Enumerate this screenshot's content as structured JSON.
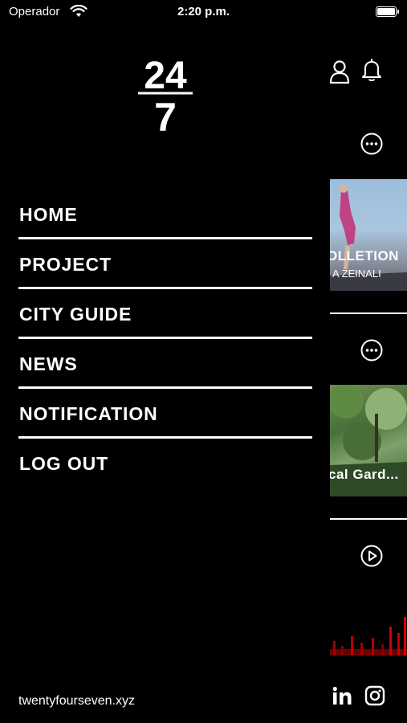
{
  "status_bar": {
    "carrier": "Operador",
    "time": "2:20 p.m."
  },
  "logo": {
    "top": "24",
    "bottom": "7"
  },
  "menu": {
    "items": [
      {
        "label": "HOME"
      },
      {
        "label": "PROJECT"
      },
      {
        "label": "CITY GUIDE"
      },
      {
        "label": "NEWS"
      },
      {
        "label": "NOTIFICATION"
      },
      {
        "label": "LOG OUT"
      }
    ]
  },
  "footer": {
    "website": "twentyfourseven.xyz"
  },
  "background_screen": {
    "card1": {
      "title": "OLLETION",
      "subtitle": "A ZEINALI"
    },
    "card2": {
      "title": "cal Gard..."
    }
  },
  "icons": [
    "wifi-icon",
    "battery-icon",
    "user-icon",
    "bell-icon",
    "more-icon",
    "play-icon",
    "linkedin-icon",
    "instagram-icon"
  ]
}
